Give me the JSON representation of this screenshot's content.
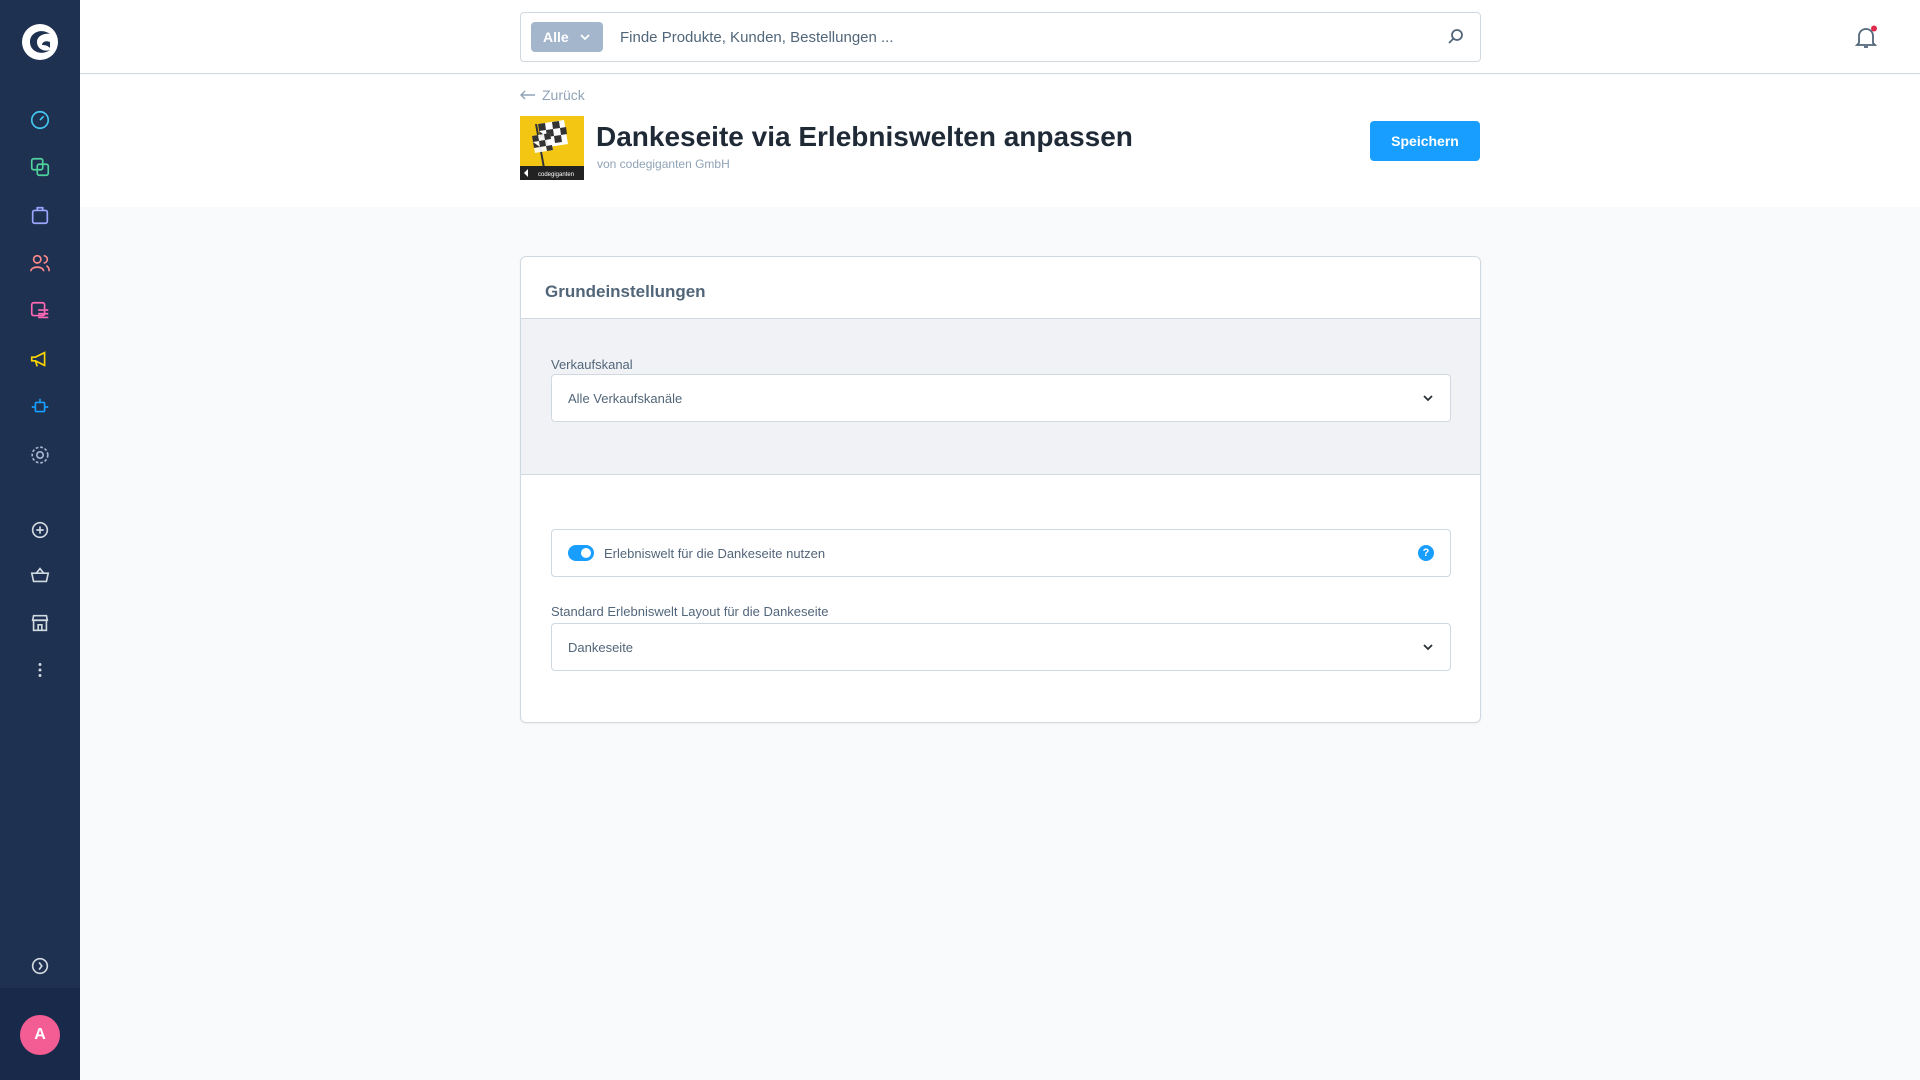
{
  "colors": {
    "sidebar": "#1f3150",
    "accent": "#189eff",
    "avatar": "#f45d93",
    "plugin_icon": "#f3c613"
  },
  "sidebar": {
    "items": [
      {
        "icon": "dashboard-icon"
      },
      {
        "icon": "catalog-icon"
      },
      {
        "icon": "orders-icon"
      },
      {
        "icon": "customers-icon"
      },
      {
        "icon": "content-icon"
      },
      {
        "icon": "marketing-icon"
      },
      {
        "icon": "extensions-icon"
      },
      {
        "icon": "settings-icon"
      },
      {
        "icon": "add-icon"
      },
      {
        "icon": "basket-icon"
      },
      {
        "icon": "store-icon"
      },
      {
        "icon": "more-icon"
      },
      {
        "icon": "collapse-icon"
      }
    ],
    "avatar_initial": "A"
  },
  "search": {
    "type_label": "Alle",
    "placeholder": "Finde Produkte, Kunden, Bestellungen ..."
  },
  "header": {
    "back_label": "Zurück",
    "title": "Dankeseite via Erlebniswelten anpassen",
    "subtitle": "von codegiganten GmbH",
    "plugin_icon_text": "codegiganten",
    "save_label": "Speichern"
  },
  "card": {
    "title": "Grundeinstellungen",
    "sales_channel_label": "Verkaufskanal",
    "sales_channel_value": "Alle Verkaufskanäle",
    "toggle_label": "Erlebniswelt für die Dankeseite nutzen",
    "toggle_on": true,
    "help_symbol": "?",
    "layout_label": "Standard Erlebniswelt Layout für die Dankeseite",
    "layout_value": "Dankeseite"
  }
}
